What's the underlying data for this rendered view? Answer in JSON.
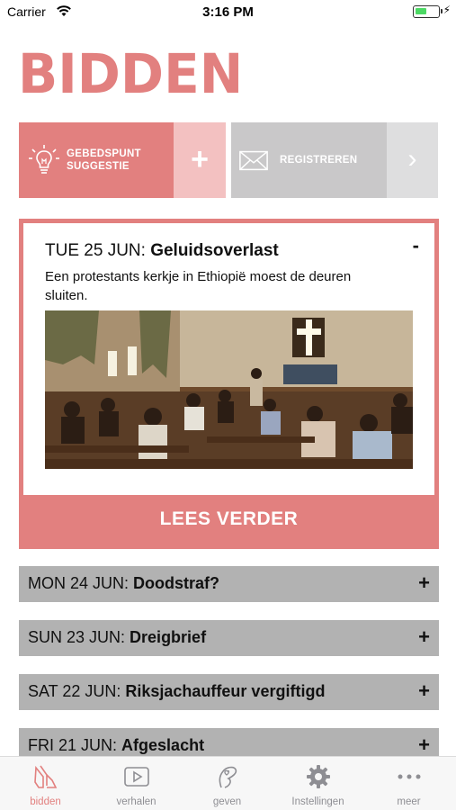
{
  "status_bar": {
    "carrier": "Carrier",
    "time": "3:16 PM"
  },
  "header": {
    "title": "BIDDEN"
  },
  "actions": {
    "suggest_line1": "GEBEDSPUNT",
    "suggest_line2": "SUGGESTIE",
    "suggest_plus": "+",
    "register_label": "REGISTREREN",
    "register_arrow": "›"
  },
  "featured": {
    "date": "TUE 25 JUN:",
    "title": "Geluidsoverlast",
    "collapse": "-",
    "description": "Een protestants kerkje in Ethiopië moest de deuren sluiten.",
    "read_more": "LEES VERDER"
  },
  "days": [
    {
      "date": "MON 24 JUN:",
      "title": "Doodstraf?",
      "toggle": "+"
    },
    {
      "date": "SUN 23 JUN:",
      "title": "Dreigbrief",
      "toggle": "+"
    },
    {
      "date": "SAT 22 JUN:",
      "title": "Riksjachauffeur vergiftigd",
      "toggle": "+"
    },
    {
      "date": "FRI 21 JUN:",
      "title": "Afgeslacht",
      "toggle": "+"
    }
  ],
  "tabs": [
    {
      "label": "bidden",
      "icon": "praying-hands-icon",
      "active": true
    },
    {
      "label": "verhalen",
      "icon": "play-icon",
      "active": false
    },
    {
      "label": "geven",
      "icon": "hand-heart-icon",
      "active": false
    },
    {
      "label": "Instellingen",
      "icon": "gear-icon",
      "active": false
    },
    {
      "label": "meer",
      "icon": "more-dots-icon",
      "active": false
    }
  ],
  "colors": {
    "accent": "#e2807f",
    "accent_light": "#f3c1c1",
    "register_gray": "#c9c8c9",
    "register_gray_light": "#dededf",
    "row_gray": "#b2b2b2",
    "tab_inactive": "#8e8e93"
  }
}
